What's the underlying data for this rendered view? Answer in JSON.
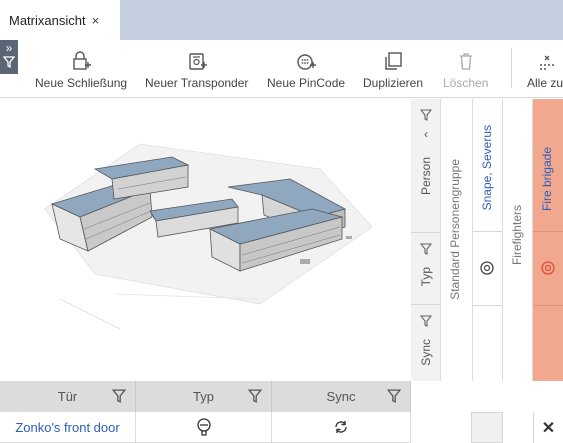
{
  "tab": {
    "title": "Matrixansicht",
    "close_glyph": "×"
  },
  "toolbar": {
    "new_lock": "Neue Schließung",
    "new_transponder": "Neuer Transponder",
    "new_pincode": "Neue PinCode",
    "duplicate": "Duplizieren",
    "delete": "Löschen",
    "all": "Alle zu"
  },
  "filters": {
    "person": "Person",
    "type": "Typ",
    "sync": "Sync"
  },
  "columns": {
    "standard_group": "Standard Personengruppe",
    "snape": "Snape, Severus",
    "firefighters": "Firefighters",
    "fire_brigade": "Fire brigade"
  },
  "grid": {
    "headers": [
      "Tür",
      "Typ",
      "Sync"
    ],
    "rows": [
      {
        "door": "Zonko's front door"
      }
    ]
  },
  "colors": {
    "accent": "#2b5fb8",
    "fire_brigade_bg": "#f2a88e",
    "transponder_red": "#e04a3a",
    "tabbar": "#c5cfe0"
  }
}
